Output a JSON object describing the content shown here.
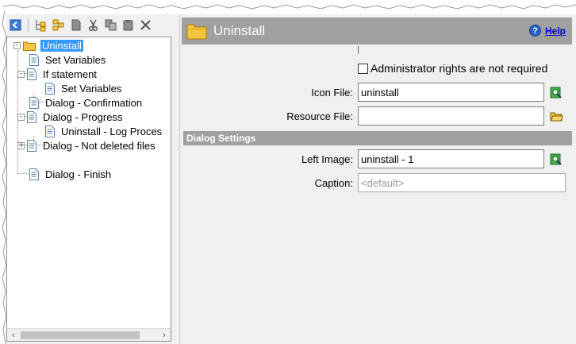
{
  "toolbar": {
    "icons": [
      "back-icon",
      "add-item-icon",
      "add-group-icon",
      "page-icon",
      "cut-icon",
      "copy-icon",
      "paste-icon",
      "delete-icon"
    ]
  },
  "tree": {
    "items": [
      {
        "label": "Uninstall",
        "icon": "folder-icon",
        "expander": "-",
        "selected": true
      },
      {
        "label": "Set Variables",
        "icon": "document-icon"
      },
      {
        "label": "If statement",
        "icon": "document-icon",
        "expander": "-"
      },
      {
        "label": "Set Variables",
        "icon": "document-icon"
      },
      {
        "label": "Dialog - Confirmation",
        "icon": "document-icon"
      },
      {
        "label": "Dialog - Progress",
        "icon": "document-icon",
        "expander": "-"
      },
      {
        "label": "Uninstall - Log Proces",
        "icon": "document-icon"
      },
      {
        "label": "Dialog - Not deleted files",
        "icon": "document-icon",
        "expander": "+"
      },
      {
        "label": "Dialog - Finish",
        "icon": "document-icon"
      }
    ],
    "scroll_left": "‹",
    "scroll_right": "›"
  },
  "panel": {
    "title": "Uninstall",
    "help_label": "Help",
    "help_glyph": "?",
    "admin_checkbox": {
      "label": "Administrator rights are not required",
      "checked": false
    },
    "fields": {
      "icon_file": {
        "label": "Icon File:",
        "value": "uninstall"
      },
      "resource_file": {
        "label": "Resource File:",
        "value": ""
      },
      "left_image": {
        "label": "Left Image:",
        "value": "uninstall - 1"
      },
      "caption": {
        "label": "Caption:",
        "placeholder": "<default>"
      }
    },
    "section_title": "Dialog Settings"
  },
  "colors": {
    "header_bg": "#a0a0a0",
    "selection": "#3399ff",
    "help_link": "#0000cc",
    "folder": "#f5c542"
  }
}
